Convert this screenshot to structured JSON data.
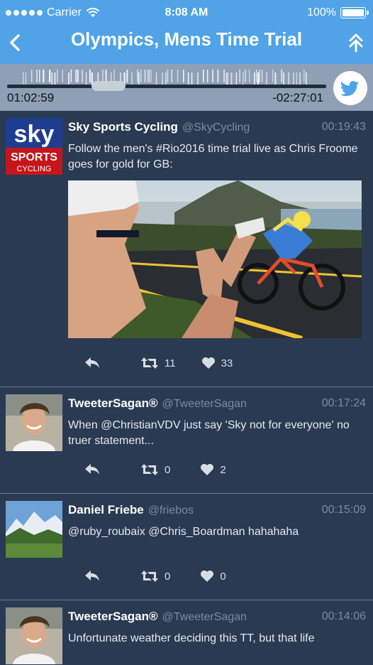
{
  "status": {
    "carrier": "Carrier",
    "time": "8:08 AM",
    "battery": "100%"
  },
  "header": {
    "title": "Olympics, Mens Time Trial"
  },
  "player": {
    "elapsed": "01:02:59",
    "remaining": "-02:27:01"
  },
  "tweets": [
    {
      "name": "Sky Sports Cycling",
      "handle": "@SkyCycling",
      "time": "00:19:43",
      "text": "Follow the men's #Rio2016 time trial live as Chris Froome goes for gold for GB:",
      "retweets": "11",
      "likes": "33",
      "avatar_text": {
        "l1": "sky",
        "l2": "SPORTS",
        "l3": "CYCLING"
      }
    },
    {
      "name": "TweeterSagan®",
      "handle": "@TweeterSagan",
      "time": "00:17:24",
      "text": "When @ChristianVDV just say 'Sky not for everyone' no truer statement...",
      "retweets": "0",
      "likes": "2"
    },
    {
      "name": "Daniel Friebe",
      "handle": "@friebos",
      "time": "00:15:09",
      "text": "@ruby_roubaix @Chris_Boardman hahahaha",
      "retweets": "0",
      "likes": "0"
    },
    {
      "name": "TweeterSagan®",
      "handle": "@TweeterSagan",
      "time": "00:14:06",
      "text": "Unfortunate weather deciding this TT, but that life"
    }
  ],
  "colors": {
    "header": "#4fa3e6",
    "background": "#2a3a52",
    "twitter": "#4fa3e6"
  }
}
